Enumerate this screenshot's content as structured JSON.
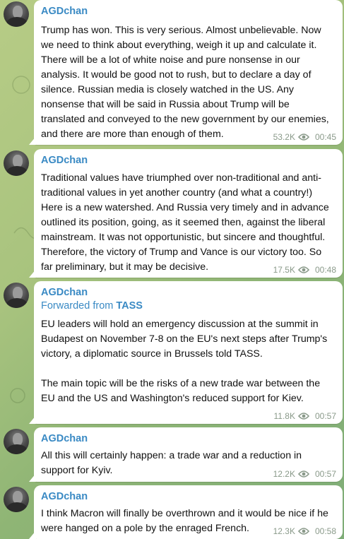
{
  "messages": [
    {
      "sender": "AGDchan",
      "forwarded": null,
      "text": "Trump has won. This is very serious. Almost unbelievable. Now we need to think about everything, weigh it up and calculate it. There will be a lot of white noise and pure nonsense in our analysis. It would be good not to rush, but to declare a day of silence. Russian media is closely watched in the US. Any nonsense that will be said in Russia about Trump will be translated and conveyed to the new government by our enemies, and there are more than enough of them.",
      "views": "53.2K",
      "time": "00:45"
    },
    {
      "sender": "AGDchan",
      "forwarded": null,
      "text": "Traditional values have triumphed over non-traditional and anti-traditional values in yet another country (and what a country!) Here is a new watershed. And Russia very timely and in advance outlined its position, going, as it seemed then, against the liberal mainstream. It was not opportunistic, but sincere and thoughtful. Therefore, the victory of Trump and Vance is our victory too. So far preliminary, but it may be decisive.",
      "views": "17.5K",
      "time": "00:48"
    },
    {
      "sender": "AGDchan",
      "forwarded": {
        "prefix": "Forwarded from",
        "source": "TASS"
      },
      "text": "EU leaders will hold an emergency discussion at the summit in Budapest on November 7-8 on the EU's next steps after Trump's victory, a diplomatic source in Brussels told TASS.\n\nThe main topic will be the risks of a new trade war between the EU and the US and Washington's reduced support for Kiev.",
      "views": "11.8K",
      "time": "00:57"
    },
    {
      "sender": "AGDchan",
      "forwarded": null,
      "text": "All this will certainly happen: a trade war and a reduction in support for Kyiv.",
      "views": "12.2K",
      "time": "00:57"
    },
    {
      "sender": "AGDchan",
      "forwarded": null,
      "text": "I think Macron will finally be overthrown and it would be nice if he were hanged on a pole by the enraged French.",
      "views": "12.3K",
      "time": "00:58"
    }
  ],
  "icons": {
    "views": "eye-icon"
  },
  "colors": {
    "sender": "#3a8ac4",
    "meta": "#8a9a8a",
    "bubble": "#ffffff"
  }
}
